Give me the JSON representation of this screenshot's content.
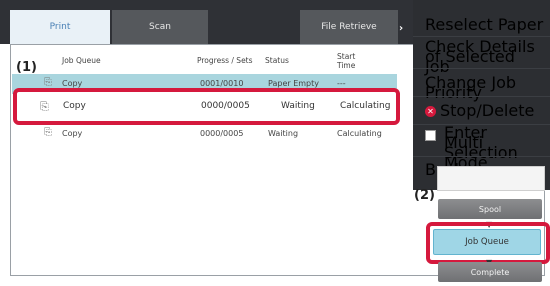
{
  "tabs": {
    "print": "Print",
    "scan": "Scan",
    "file_retrieve": "File Retrieve"
  },
  "table": {
    "headers": {
      "job_queue": "Job Queue",
      "progress_sets": "Progress / Sets",
      "status": "Status",
      "start_time": "Start Time"
    },
    "rows": [
      {
        "name": "Copy",
        "progress": "0001/0010",
        "status": "Paper Empty",
        "start": "---"
      },
      {
        "name": "Copy",
        "progress": "0000/0005",
        "status": "Waiting",
        "start": "Calculating"
      },
      {
        "name": "Copy",
        "progress": "0000/0005",
        "status": "Waiting",
        "start": "Calculating"
      }
    ]
  },
  "menu": {
    "reselect_paper": "Reselect Paper",
    "check_details": "Check Details of Selected Job",
    "change_priority": "Change Job Priority",
    "stop_delete": "Stop/Delete",
    "multi_selection": "Enter Multi Selection Mode",
    "back": "Back"
  },
  "buttons": {
    "spool": "Spool",
    "job_queue": "Job Queue",
    "complete": "Complete"
  },
  "annotations": {
    "one": "(1)",
    "two": "(2)"
  }
}
